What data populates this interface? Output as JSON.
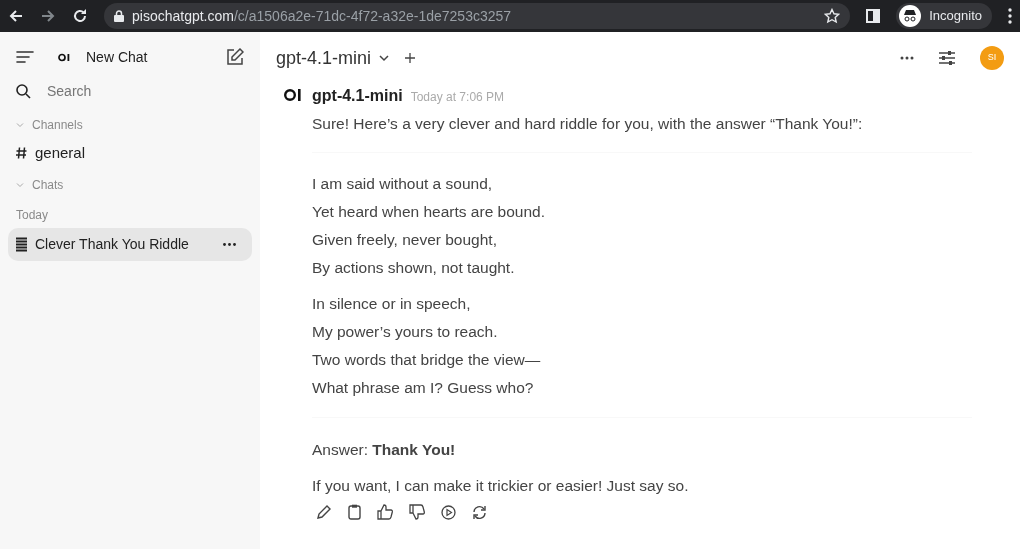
{
  "browser": {
    "url_host": "pisochatgpt.com",
    "url_path": "/c/a1506a2e-71dc-4f72-a32e-1de7253c3257",
    "profile": "Incognito"
  },
  "sidebar": {
    "new_chat": "New Chat",
    "search": {
      "placeholder": "Search"
    },
    "sections": [
      {
        "kind": "channels",
        "label": "Channels",
        "expanded": true,
        "items": [
          {
            "label": "general"
          }
        ]
      },
      {
        "kind": "chats",
        "label": "Chats",
        "expanded": true,
        "groups": [
          {
            "label": "Today",
            "items": [
              {
                "label": "Clever Thank You Riddle",
                "selected": true
              }
            ]
          }
        ]
      }
    ]
  },
  "header": {
    "model": "gpt-4.1-mini",
    "avatar": "SI"
  },
  "message": {
    "model": "gpt-4.1-mini",
    "time": "Today at 7:06 PM",
    "intro": "Sure! Here’s a very clever and hard riddle for you, with the answer “Thank You!”:",
    "stanzas": [
      [
        "I am said without a sound,",
        "Yet heard when hearts are bound.",
        "Given freely, never bought,",
        "By actions shown, not taught."
      ],
      [
        "In silence or in speech,",
        "My power’s yours to reach.",
        "Two words that bridge the view—",
        "What phrase am I? Guess who?"
      ]
    ],
    "answer": "Answer: **Thank You!**",
    "closing": "If you want, I can make it trickier or easier! Just say so."
  }
}
